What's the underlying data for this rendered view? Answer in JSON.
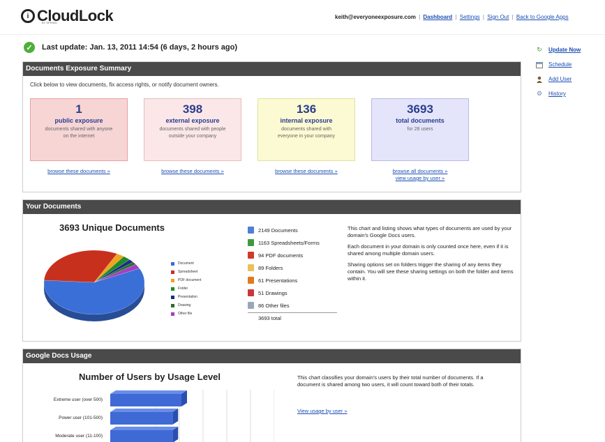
{
  "header": {
    "logo_mark": "i",
    "logo_text": "CloudLock",
    "logo_sub": "BY SPRING",
    "email": "keith@everyoneexposure.com",
    "links": [
      "Dashboard",
      "Settings",
      "Sign Out",
      "Back to Google Apps"
    ]
  },
  "status": {
    "text": "Last update: Jan. 13, 2011 14:54 (6 days, 2 hours ago)"
  },
  "sidebar": {
    "items": [
      {
        "label": "Update Now",
        "icon": "refresh-icon"
      },
      {
        "label": "Schedule",
        "icon": "calendar-icon"
      },
      {
        "label": "Add User",
        "icon": "person-icon"
      },
      {
        "label": "History",
        "icon": "gear-icon"
      }
    ]
  },
  "exposure": {
    "title": "Documents Exposure Summary",
    "intro": "Click below to view documents, fix access rights, or notify document owners.",
    "boxes": [
      {
        "num": "1",
        "label": "public exposure",
        "desc": "documents shared with anyone on the internet",
        "link": "browse these documents »",
        "link2": ""
      },
      {
        "num": "398",
        "label": "external exposure",
        "desc": "documents shared with people outside your company",
        "link": "browse these documents »",
        "link2": ""
      },
      {
        "num": "136",
        "label": "internal exposure",
        "desc": "documents shared with everyone in your company",
        "link": "browse these documents »",
        "link2": ""
      },
      {
        "num": "3693",
        "label": "total documents",
        "desc": "for 28 users",
        "link": "browse all documents »",
        "link2": "view usage by user »"
      }
    ]
  },
  "your_docs": {
    "title": "Your Documents",
    "chart_title": "3693 Unique Documents",
    "legend": [
      {
        "label": "Document",
        "color": "#3a6fd8"
      },
      {
        "label": "Spreadsheet",
        "color": "#c8301e"
      },
      {
        "label": "PDF document",
        "color": "#f0a31c"
      },
      {
        "label": "Folder",
        "color": "#1e8a2b"
      },
      {
        "label": "Presentation",
        "color": "#1a2f84"
      },
      {
        "label": "Drawing",
        "color": "#2b6e2b"
      },
      {
        "label": "Other file",
        "color": "#a13fc1"
      }
    ],
    "list": [
      {
        "label": "2149 Documents",
        "icon": "document-icon",
        "color": "#4f7fd9"
      },
      {
        "label": "1163 Spreadsheets/Forms",
        "icon": "spreadsheet-icon",
        "color": "#3f9a3f"
      },
      {
        "label": "94 PDF documents",
        "icon": "pdf-icon",
        "color": "#d23a2a"
      },
      {
        "label": "89 Folders",
        "icon": "folder-icon",
        "color": "#e8c15a"
      },
      {
        "label": "61 Presentations",
        "icon": "presentation-icon",
        "color": "#e07a1f"
      },
      {
        "label": "51 Drawings",
        "icon": "drawing-icon",
        "color": "#c93838"
      },
      {
        "label": "86 Other files",
        "icon": "file-icon",
        "color": "#9aa7b8"
      }
    ],
    "total": "3693 total",
    "explain": [
      "This chart and listing shows what types of documents are used by your domain's Google Docs users.",
      "Each document in your domain is only counted once here, even if it is shared among multiple domain users.",
      "Sharing options set on folders trigger the sharing of any items they contain. You will see these sharing settings on both the folder and items within it."
    ]
  },
  "usage": {
    "title": "Google Docs Usage",
    "chart_title": "Number of Users by Usage Level",
    "text": "This chart classifies your domain's users by their total number of documents. If a document is shared among two users, it will count toward both of their totals.",
    "link": "View usage by user »"
  },
  "chart_data": [
    {
      "type": "pie",
      "title": "3693 Unique Documents",
      "categories": [
        "Document",
        "Spreadsheet",
        "PDF document",
        "Folder",
        "Presentation",
        "Drawing",
        "Other file"
      ],
      "values": [
        2149,
        1163,
        94,
        89,
        61,
        51,
        86
      ]
    },
    {
      "type": "bar",
      "title": "Number of Users by Usage Level",
      "categories": [
        "Extreme user (over 500)",
        "Power user (101-500)",
        "Moderate user (11-100)"
      ],
      "values": [
        8,
        7,
        7
      ]
    }
  ]
}
